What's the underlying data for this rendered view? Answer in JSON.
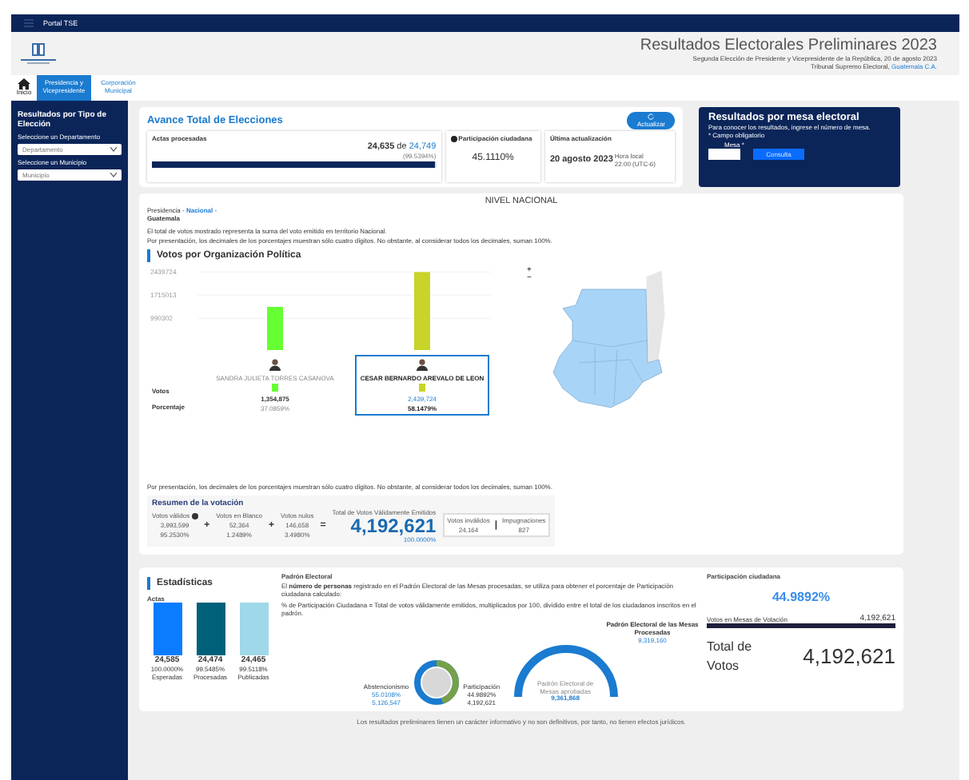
{
  "topbar": {
    "title": "Portal TSE"
  },
  "header": {
    "title": "Resultados Electorales Preliminares 2023",
    "subtitle": "Segunda Elección de Presidente y Vicepresidente de la República, 20 de agosto 2023",
    "org": "Tribunal Supremo Electoral,",
    "place": "Guatemala C.A."
  },
  "tabs": [
    {
      "label": "Inicio",
      "kind": "home",
      "selected": false
    },
    {
      "label": "Presidencia y Vicepresidente",
      "kind": "text",
      "selected": true
    },
    {
      "label": "Corporación Municipal",
      "kind": "text",
      "selected": false
    }
  ],
  "sidebar": {
    "title": "Resultados por Tipo de Elección",
    "fields": [
      {
        "label": "Seleccione un Departamento",
        "placeholder": "Departamento"
      },
      {
        "label": "Seleccione un Municipio",
        "placeholder": "Municipio"
      }
    ]
  },
  "avance": {
    "title": "Avance Total de Elecciones",
    "button": "Actualizar",
    "actas_label": "Actas procesadas",
    "actas_done": "24,635",
    "actas_of": "de",
    "actas_total": "24,749",
    "actas_pct": "(99.5394%)",
    "level": 0.9954,
    "participation_label": "Participación ciudadana",
    "participation": "45.1110%",
    "update_label": "Última actualización",
    "update_date": "20 agosto 2023",
    "update_time_label": "Hora local",
    "update_time": "22:00 (UTC-6)"
  },
  "mesa": {
    "title": "Resultados por mesa electoral",
    "info": "Para conocer los resultados, ingrese el número de mesa.",
    "required": "* Campo obligatorio",
    "field_label": "Mesa *",
    "button": "Consulta"
  },
  "nacional": {
    "title": "NIVEL NACIONAL",
    "crumb_1": "Presidencia -",
    "crumb_2": "Nacional",
    "crumb_3": "-",
    "crumb_4": "Guatemala",
    "note_1": "El total de votos mostrado representa la suma del voto emitido en territorio Nacional.",
    "note_2": "Por presentación, los decimales de los porcentajes muestran sólo cuatro dígitos. No obstante, al considerar todos los decimales, suman 100%.",
    "section": "Votos por Organización Política",
    "chart_data": {
      "type": "bar",
      "values": [
        1350000,
        2440000
      ],
      "ylim": [
        0,
        2500000
      ],
      "yticks": [
        {
          "value": 2439724,
          "label": "2439724"
        },
        {
          "value": 1715013,
          "label": "1715013"
        },
        {
          "value": 990302,
          "label": "990302"
        }
      ]
    },
    "row_votes": "Votos",
    "row_pct": "Porcentaje",
    "candidates": [
      {
        "name": "SANDRA JULIETA TORRES CASANOVA",
        "votes": "1,354,875",
        "pct": "37.0859%",
        "color": "#66ff33",
        "selected": false
      },
      {
        "name": "CESAR BERNARDO AREVALO DE LEON",
        "votes": "2,439,724",
        "pct": "58.1479%",
        "color": "#c8d42a",
        "selected": true
      }
    ],
    "zoom_in": "+",
    "zoom_out": "−",
    "footnote": "Por presentación, los decimales de los porcentajes muestran sólo cuatro dígitos. No obstante, al considerar todos los decimales, suman 100%."
  },
  "resumen": {
    "title": "Resumen de la votación",
    "parts": [
      {
        "label": "Votos válidos",
        "value": "3,993,599",
        "pct": "95.2530%",
        "info": true,
        "op": "+"
      },
      {
        "label": "Votos en Blanco",
        "value": "52,364",
        "pct": "1.2489%",
        "info": false,
        "op": "+"
      },
      {
        "label": "Votos nulos",
        "value": "146,658",
        "pct": "3.4980%",
        "info": false,
        "op": "="
      }
    ],
    "total_label": "Total de Votos Válidamente Emitidos",
    "total": "4,192,621",
    "total_pct": "100.0000%",
    "invalid_label": "Votos inválidos",
    "invalid": "24,164",
    "sep": "|",
    "imp_label": "Impugnaciones",
    "imp": "827"
  },
  "stats": {
    "title": "Estadísticas",
    "actas_title": "Actas",
    "actas": [
      {
        "value": "24,585",
        "pct": "100.0000%",
        "label": "Esperadas",
        "color": "#0a7cff"
      },
      {
        "value": "24,474",
        "pct": "99.5485%",
        "label": "Procesadas",
        "color": "#00607a"
      },
      {
        "value": "24,465",
        "pct": "99.5118%",
        "label": "Publicadas",
        "color": "#9fd8e8"
      }
    ],
    "padron_title": "Padrón Electoral",
    "padron_text": "El **número de personas** registrado en el Padrón Electoral de las Mesas procesadas, se utiliza para obtener el porcentaje de Participación ciudadana calculado:",
    "padron_formula": "% de Participación Ciudadana = Total de votos válidamente emitidos, multiplicados por 100, dividido entre el total de los ciudadanos inscritos en el padrón.",
    "padron_mesas_label": "Padrón Electoral de las Mesas Procesadas",
    "padron_mesas": "9,319,160",
    "abst_label": "Abstencionismo",
    "abst_pct": "55.0108%",
    "abst": "5,126,547",
    "part_label": "Participación",
    "part_pct": "44.9892%",
    "part": "4,192,621",
    "level": 0.4499,
    "gauge_label": "Padrón Electoral de Mesas aprobadas",
    "gauge": "9,361,868",
    "pc_title": "Participación ciudadana",
    "pc_value": "44.9892%",
    "votes_label": "Votos en Mesas de Votación",
    "votes": "4,192,621",
    "total_label": "Total de Votos",
    "total": "4,192,621"
  },
  "footer": "Los resultados preliminares tienen un carácter informativo y no son definitivos, por tanto, no tienen efectos jurídicos."
}
